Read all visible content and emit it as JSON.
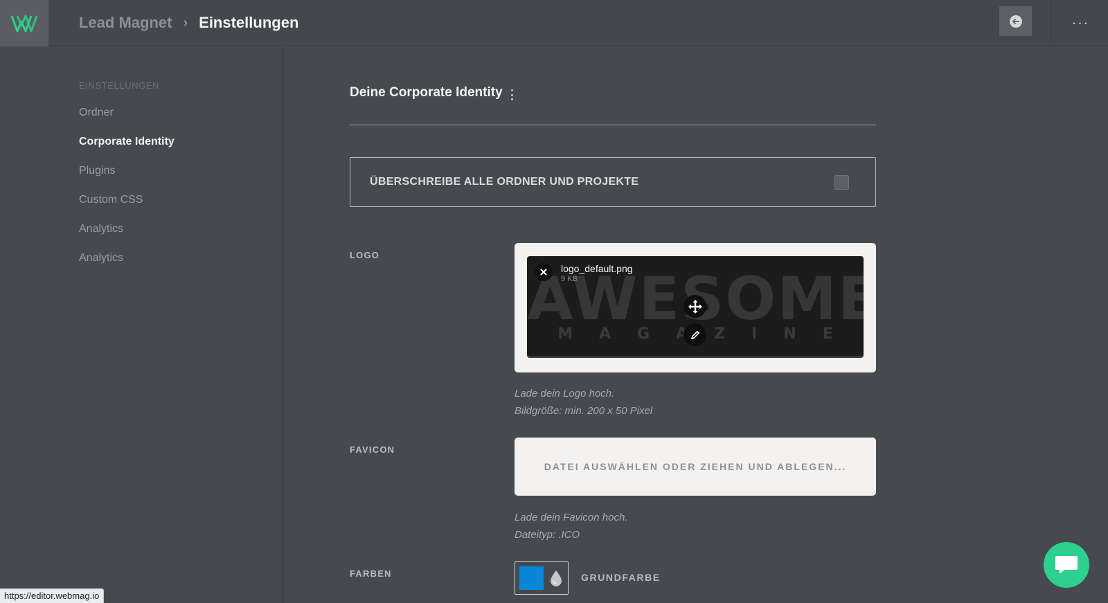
{
  "header": {
    "breadcrumb_parent": "Lead Magnet",
    "breadcrumb_separator": "›",
    "breadcrumb_current": "Einstellungen",
    "more_label": "···"
  },
  "sidebar": {
    "heading": "EINSTELLUNGEN",
    "items": [
      {
        "label": "Ordner",
        "active": false
      },
      {
        "label": "Corporate Identity",
        "active": true
      },
      {
        "label": "Plugins",
        "active": false
      },
      {
        "label": "Custom CSS",
        "active": false
      },
      {
        "label": "Analytics",
        "active": false
      },
      {
        "label": "Analytics",
        "active": false
      }
    ]
  },
  "main": {
    "title": "Deine Corporate Identity",
    "override_label": "ÜBERSCHREIBE ALLE ORDNER UND PROJEKTE",
    "override_checked": false,
    "logo": {
      "label": "LOGO",
      "file_name": "logo_default.png",
      "file_size": "9 KB",
      "preview_line1": "AWESOME",
      "preview_line2": "MAGAZINE",
      "hint_line1": "Lade dein Logo hoch.",
      "hint_line2": "Bildgröße: min. 200 x 50 Pixel"
    },
    "favicon": {
      "label": "FAVICON",
      "drop_text": "DATEI AUSWÄHLEN ODER ZIEHEN UND ABLEGEN...",
      "hint_line1": "Lade dein Favicon hoch.",
      "hint_line2": "Dateityp: .ICO"
    },
    "colors": {
      "label": "FARBEN",
      "primary_label": "GRUNDFARBE",
      "primary_color": "#0a86d6"
    }
  },
  "status_bar": {
    "url": "https://editor.webmag.io"
  },
  "theme": {
    "accent": "#2dd08e",
    "background": "#464a4f"
  }
}
